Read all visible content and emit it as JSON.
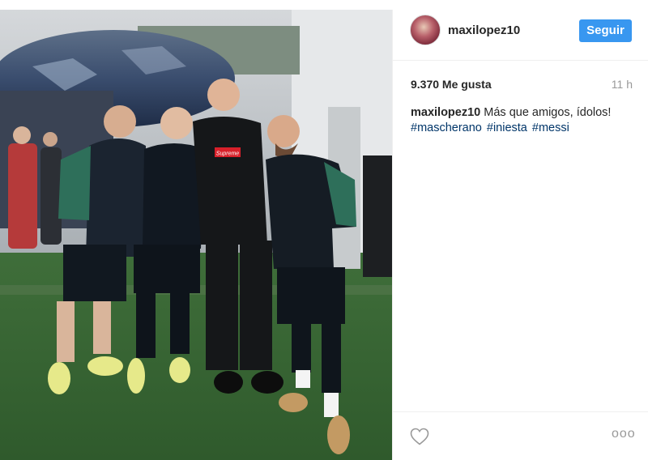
{
  "post": {
    "username": "maxilopez10",
    "follow_label": "Seguir",
    "likes": "9.370 Me gusta",
    "time_ago": "11 h",
    "caption_user": "maxilopez10",
    "caption_text": "Más que amigos, ídolos!",
    "hashtags": [
      "#mascherano",
      "#iniesta",
      "#messi"
    ],
    "more_label": "ooo"
  },
  "photo": {
    "shirt_print": "Supreme"
  },
  "colors": {
    "follow_button": "#3897f0",
    "hashtag": "#003569",
    "muted": "#999999"
  },
  "icons": [
    "heart-icon",
    "more-options-icon"
  ]
}
